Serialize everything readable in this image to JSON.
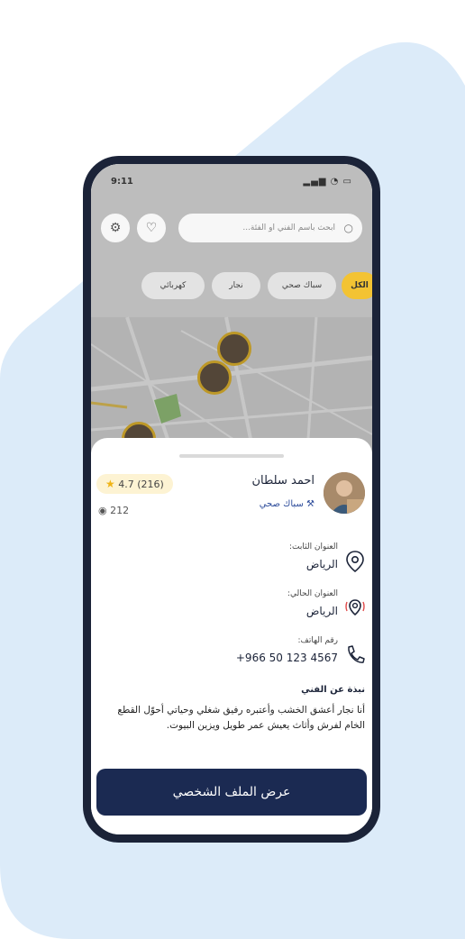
{
  "colors": {
    "accent": "#1b2a52",
    "rating_badge": "#fdf3d3",
    "star": "#f0b416",
    "active_chip": "#f3c333",
    "page_blob": "#dcebf9"
  },
  "status_bar": {
    "time": "9:11",
    "icons": "signal wifi battery"
  },
  "search": {
    "placeholder": "ابحث باسم الفني او الفئة..."
  },
  "chips": [
    "الكل",
    "سباك صحي",
    "نجار",
    "كهربائي"
  ],
  "technician": {
    "name": "احمد سلطان",
    "profession": "سباك صحي",
    "rating": "4.7",
    "reviews": "(216)",
    "views": "212"
  },
  "info": {
    "fixed_address_label": "العنوان الثابت:",
    "fixed_address_value": "الرياض",
    "current_address_label": "العنوان الحالي:",
    "current_address_value": "الرياض",
    "phone_label": "رقم الهاتف:",
    "phone_value": "+966 50 123 4567"
  },
  "bio": {
    "title": "نبذة عن الفني",
    "text": "أنا نجار أعشق الخشب وأعتبره رفيق شغلي وحياتي أحوّل القطع الخام لفرش وأثاث يعيش عمر طويل ويزين البيوت."
  },
  "cta_label": "عرض الملف الشخصي"
}
